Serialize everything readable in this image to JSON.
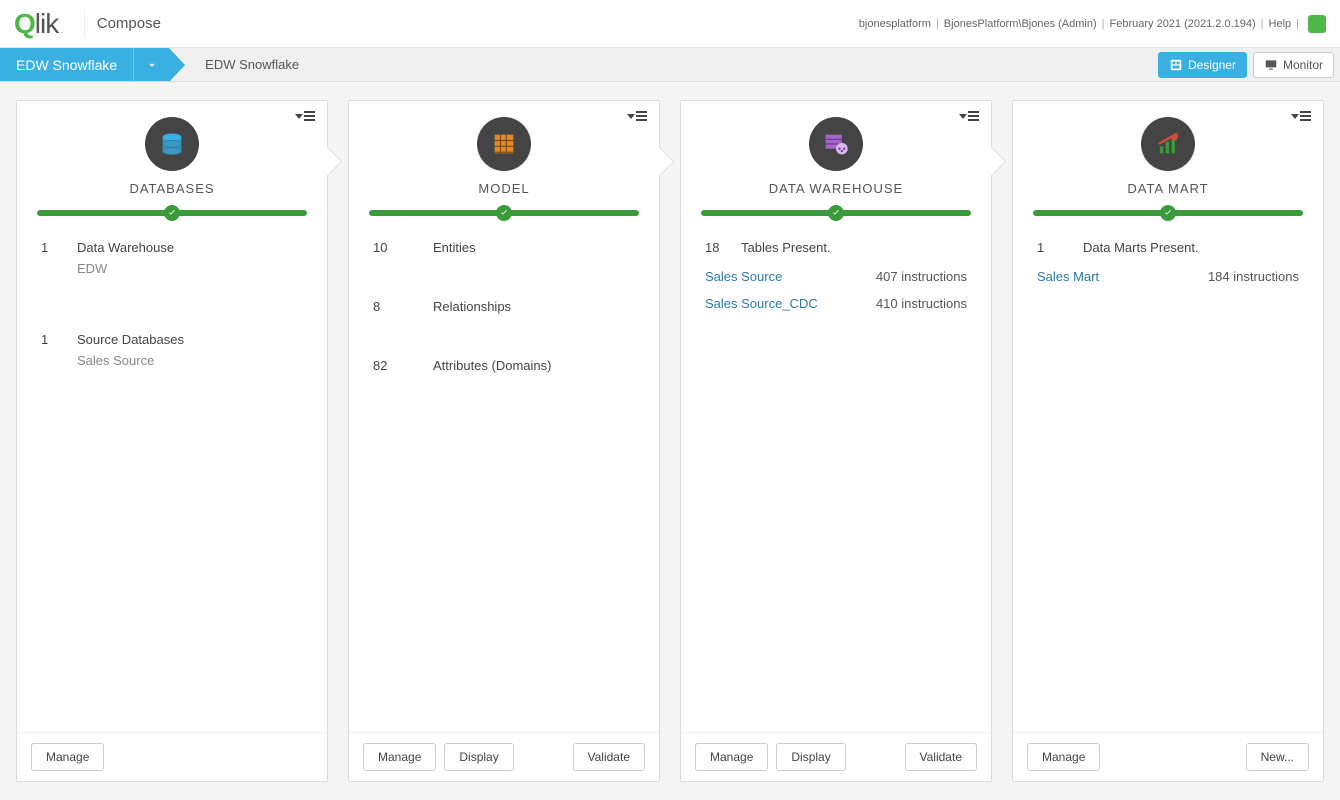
{
  "header": {
    "brand_q": "Q",
    "brand_rest": "lik",
    "brand_tm": ".",
    "product": "Compose",
    "tenant": "bjonesplatform",
    "user": "BjonesPlatform\\Bjones (Admin)",
    "version": "February 2021 (2021.2.0.194)",
    "help": "Help"
  },
  "nav": {
    "project": "EDW Snowflake",
    "crumb": "EDW Snowflake",
    "designer": "Designer",
    "monitor": "Monitor"
  },
  "cards": {
    "databases": {
      "title": "DATABASES",
      "dw_count": "1",
      "dw_label": "Data Warehouse",
      "dw_name": "EDW",
      "src_count": "1",
      "src_label": "Source Databases",
      "src_name": "Sales Source",
      "manage": "Manage"
    },
    "model": {
      "title": "MODEL",
      "entities_n": "10",
      "entities_l": "Entities",
      "rel_n": "8",
      "rel_l": "Relationships",
      "attr_n": "82",
      "attr_l": "Attributes (Domains)",
      "manage": "Manage",
      "display": "Display",
      "validate": "Validate"
    },
    "dwh": {
      "title": "DATA WAREHOUSE",
      "tables_n": "18",
      "tables_l": "Tables Present.",
      "r1_name": "Sales Source",
      "r1_instr": "407 instructions",
      "r2_name": "Sales Source_CDC",
      "r2_instr": "410 instructions",
      "manage": "Manage",
      "display": "Display",
      "validate": "Validate"
    },
    "mart": {
      "title": "DATA MART",
      "marts_n": "1",
      "marts_l": "Data Marts Present.",
      "r1_name": "Sales Mart",
      "r1_instr": "184 instructions",
      "manage": "Manage",
      "new": "New..."
    }
  }
}
